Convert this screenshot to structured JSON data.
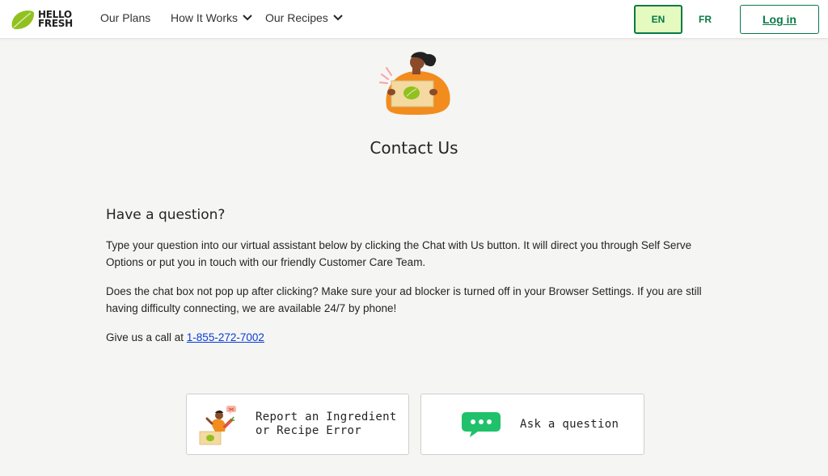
{
  "brand": {
    "line1": "HELLO",
    "line2": "FRESH",
    "green": "#91c11e",
    "dark_green": "#067a46"
  },
  "nav": {
    "items": [
      {
        "label": "Our Plans",
        "has_dropdown": false
      },
      {
        "label": "How It Works",
        "has_dropdown": true
      },
      {
        "label": "Our Recipes",
        "has_dropdown": true
      }
    ],
    "languages": [
      {
        "label": "EN",
        "selected": true
      },
      {
        "label": "FR",
        "selected": false
      }
    ],
    "login_label": "Log in"
  },
  "page": {
    "title": "Contact Us"
  },
  "help": {
    "heading": "Have a question?",
    "para1": "Type your question into our virtual assistant below by clicking the Chat with Us button. It will direct you through Self Serve Options or put you in touch with our friendly Customer Care Team.",
    "para2": "Does the chat box not pop up after clicking? Make sure your ad blocker is turned off in your Browser Settings. If you are still having difficulty connecting, we are available 24/7 by phone!",
    "call_prefix": "Give us a call at ",
    "phone": "1-855-272-7002"
  },
  "cards": [
    {
      "line1": "Report an Ingredient",
      "line2": "or Recipe Error",
      "icon": "chef-icon"
    },
    {
      "label": "Ask a question",
      "icon": "chat-bubble-icon"
    }
  ]
}
